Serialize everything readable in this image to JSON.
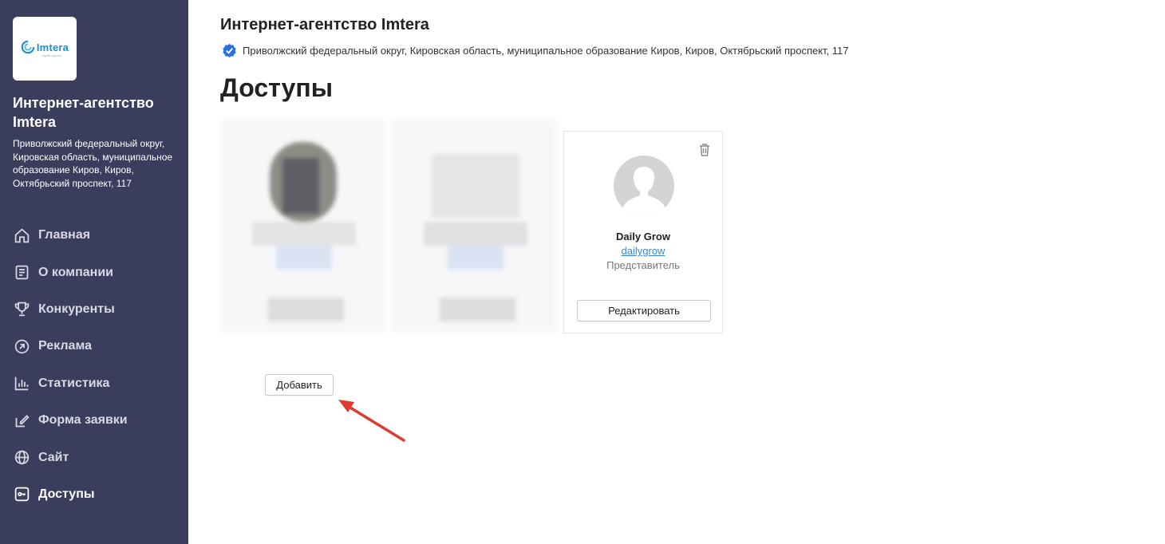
{
  "sidebar": {
    "logo_text": "Imtera",
    "logo_tagline": "digital agency",
    "company_name": "Интернет-агентство Imtera",
    "company_address": "Приволжский федеральный округ, Кировская область, муниципальное образование Киров, Киров, Октябрьский проспект, 117",
    "nav": [
      {
        "label": "Главная",
        "icon": "home-icon",
        "active": false
      },
      {
        "label": "О компании",
        "icon": "document-icon",
        "active": false
      },
      {
        "label": "Конкуренты",
        "icon": "trophy-icon",
        "active": false
      },
      {
        "label": "Реклама",
        "icon": "arrow-circle-icon",
        "active": false
      },
      {
        "label": "Статистика",
        "icon": "bar-chart-icon",
        "active": false
      },
      {
        "label": "Форма заявки",
        "icon": "pencil-icon",
        "active": false
      },
      {
        "label": "Сайт",
        "icon": "globe-icon",
        "active": false
      },
      {
        "label": "Доступы",
        "icon": "key-icon",
        "active": true
      }
    ]
  },
  "header": {
    "title": "Интернет-агентство Imtera",
    "address": "Приволжский федеральный округ, Кировская область, муниципальное образование Киров, Киров, Октябрьский проспект, 117",
    "verified_icon": "verified-check-icon"
  },
  "page": {
    "heading": "Доступы"
  },
  "access_card": {
    "name": "Daily Grow",
    "login": "dailygrow",
    "role": "Представитель",
    "edit_label": "Редактировать"
  },
  "actions": {
    "add_label": "Добавить"
  },
  "colors": {
    "sidebar_bg": "#3a3d5c",
    "link": "#3a86d1",
    "verified": "#2b6fe0",
    "arrow": "#e03a2f"
  }
}
